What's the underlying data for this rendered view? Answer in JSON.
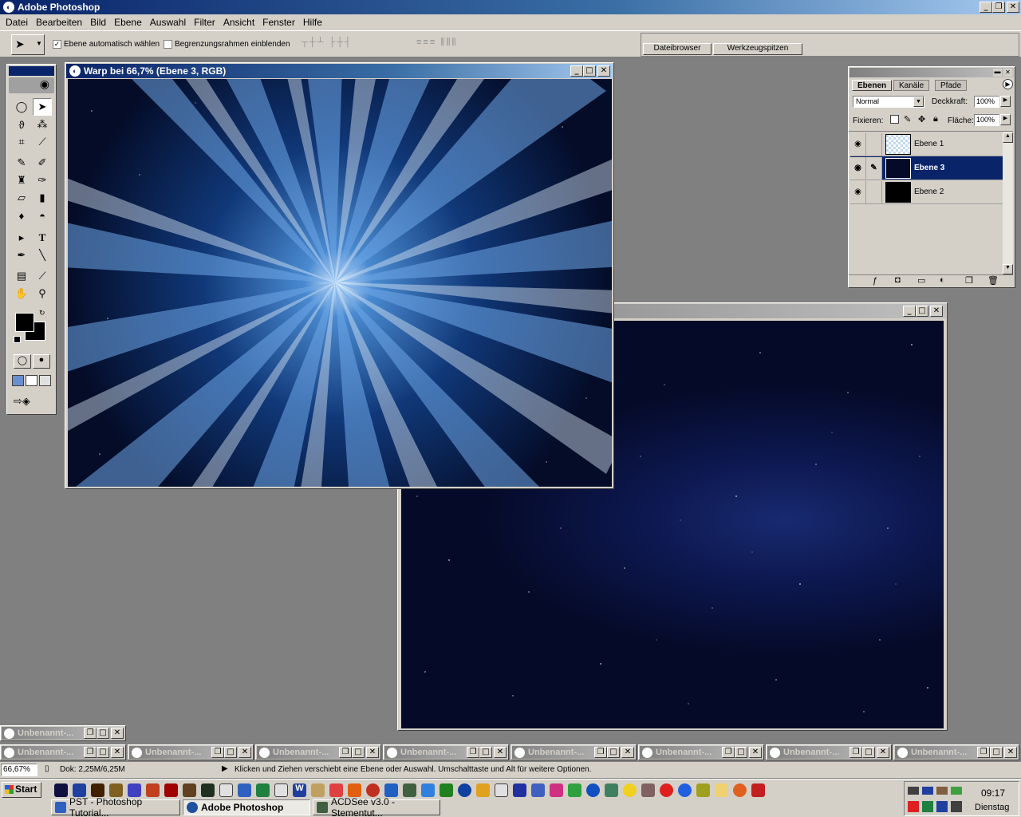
{
  "app": {
    "title": "Adobe Photoshop"
  },
  "menu": [
    "Datei",
    "Bearbeiten",
    "Bild",
    "Ebene",
    "Auswahl",
    "Filter",
    "Ansicht",
    "Fenster",
    "Hilfe"
  ],
  "options": {
    "auto_select_label": "Ebene automatisch wählen",
    "auto_select_checked": true,
    "bounding_box_label": "Begrenzungsrahmen einblenden",
    "bounding_box_checked": false,
    "well_tabs": [
      "Dateibrowser",
      "Werkzeugspitzen"
    ]
  },
  "documents": {
    "warp_title": "Warp bei 66,7% (Ebene 3, RGB)",
    "second_title": ""
  },
  "layers_panel": {
    "tabs": [
      "Ebenen",
      "Kanäle",
      "Pfade"
    ],
    "blend_mode": "Normal",
    "opacity_label": "Deckkraft:",
    "opacity_value": "100%",
    "lock_label": "Fixieren:",
    "fill_label": "Fläche:",
    "fill_value": "100%",
    "layers": [
      {
        "name": "Ebene 1",
        "selected": false
      },
      {
        "name": "Ebene 3",
        "selected": true
      },
      {
        "name": "Ebene 2",
        "selected": false
      }
    ]
  },
  "minimized": {
    "label": "Unbenannt-..."
  },
  "status": {
    "zoom": "66,67%",
    "doc_size": "Dok: 2,25M/6,25M",
    "hint": "Klicken und Ziehen verschiebt eine Ebene oder Auswahl. Umschalttaste und Alt für weitere Optionen."
  },
  "taskbar": {
    "start_label": "Start",
    "tasks": [
      "PST - Photoshop Tutorial...",
      "Adobe Photoshop",
      "ACDSee v3.0 - Stementut..."
    ],
    "clock_time": "09:17",
    "clock_day": "Dienstag"
  }
}
